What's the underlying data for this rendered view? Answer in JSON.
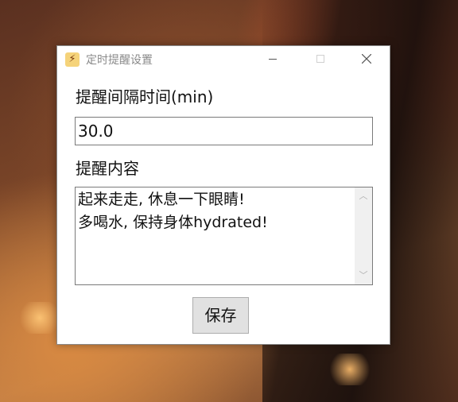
{
  "window": {
    "title": "定时提醒设置",
    "app_icon": "app-icon"
  },
  "form": {
    "interval_label": "提醒间隔时间(min)",
    "interval_value": "30.0",
    "content_label": "提醒内容",
    "content_value": "起来走走, 休息一下眼睛!\n多喝水, 保持身体hydrated!",
    "save_label": "保存"
  }
}
